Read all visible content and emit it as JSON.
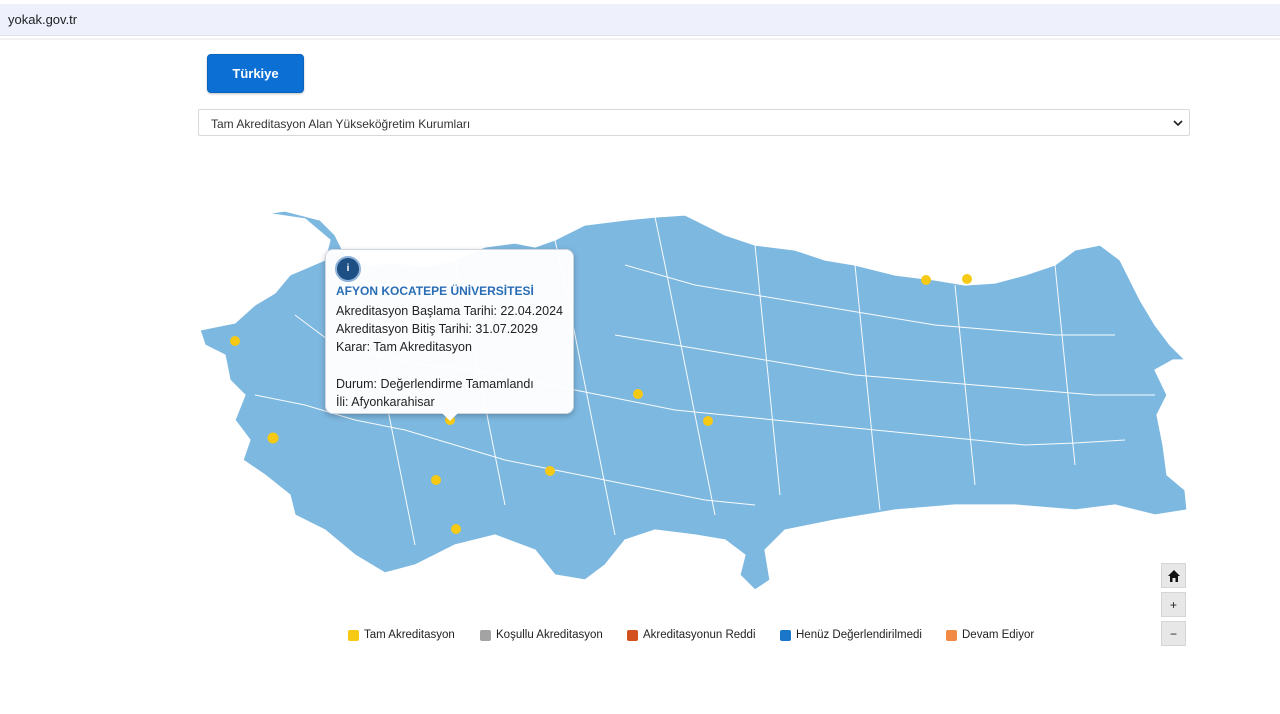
{
  "browser": {
    "url": "yokak.gov.tr"
  },
  "toolbar": {
    "country_button": "Türkiye"
  },
  "filter": {
    "selected": "Tam Akreditasyon Alan Yükseköğretim Kurumları"
  },
  "popup": {
    "title": "AFYON KOCATEPE ÜNİVERSİTESİ",
    "start": "Akreditasyon Başlama Tarihi: 22.04.2024",
    "end": "Akreditasyon Bitiş Tarihi: 31.07.2029",
    "decision": "Karar: Tam Akreditasyon",
    "status": "Durum: Değerlendirme Tamamlandı",
    "province": "İli: Afyonkarahisar"
  },
  "map_controls": {
    "home_icon": "home-icon",
    "zoom_in": "+",
    "zoom_out": "−"
  },
  "legend": [
    {
      "label": "Tam Akreditasyon",
      "color": "#f6c914"
    },
    {
      "label": "Koşullu Akreditasyon",
      "color": "#a3a3a3"
    },
    {
      "label": "Akreditasyonun Reddi",
      "color": "#d3501f"
    },
    {
      "label": "Henüz Değerlendirilmedi",
      "color": "#1a76c8"
    },
    {
      "label": "Devam Ediyor",
      "color": "#f08a44"
    }
  ],
  "colors": {
    "map_fill": "#7db8e0",
    "map_border": "#ffffff",
    "accent": "#0b6fd4",
    "marker": "#f6c914"
  }
}
